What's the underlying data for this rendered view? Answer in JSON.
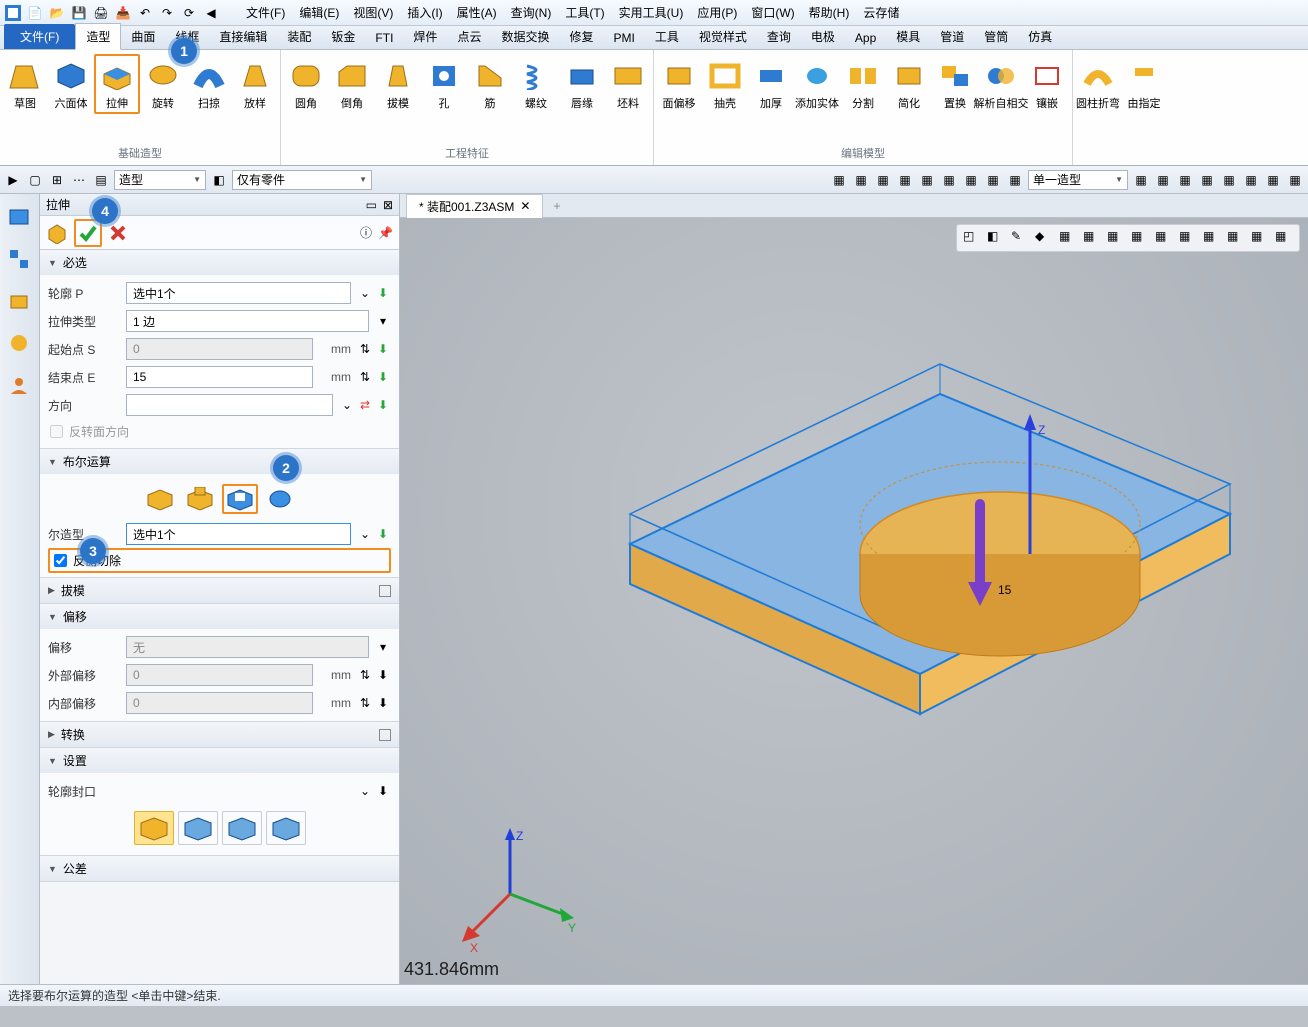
{
  "menu": [
    "文件(F)",
    "编辑(E)",
    "视图(V)",
    "插入(I)",
    "属性(A)",
    "查询(N)",
    "工具(T)",
    "实用工具(U)",
    "应用(P)",
    "窗口(W)",
    "帮助(H)",
    "云存储"
  ],
  "tabs": {
    "file": "文件(F)",
    "items": [
      "造型",
      "曲面",
      "线框",
      "直接编辑",
      "装配",
      "钣金",
      "FTI",
      "焊件",
      "点云",
      "数据交换",
      "修复",
      "PMI",
      "工具",
      "视觉样式",
      "查询",
      "电极",
      "App",
      "模具",
      "管道",
      "管筒",
      "仿真"
    ],
    "active": "造型"
  },
  "ribbon": {
    "g1": {
      "label": "基础造型",
      "btns": [
        "草图",
        "六面体",
        "拉伸",
        "旋转",
        "扫掠",
        "放样"
      ]
    },
    "g2": {
      "label": "工程特征",
      "btns": [
        "圆角",
        "倒角",
        "拔模",
        "孔",
        "筋",
        "螺纹",
        "唇缘",
        "坯料"
      ]
    },
    "g3": {
      "label": "编辑模型",
      "btns": [
        "面偏移",
        "抽壳",
        "加厚",
        "添加实体",
        "分割",
        "简化",
        "置换",
        "解析自相交",
        "镶嵌"
      ]
    },
    "g4": {
      "label": "",
      "btns": [
        "圆柱折弯",
        "由指定"
      ]
    }
  },
  "qselects": {
    "mode": "造型",
    "filter": "仅有零件",
    "display": "单一造型"
  },
  "panel": {
    "title": "拉伸",
    "s_required": "必选",
    "profile_l": "轮廓 P",
    "profile_v": "选中1个",
    "type_l": "拉伸类型",
    "type_v": "1 边",
    "start_l": "起始点 S",
    "start_v": "0",
    "end_l": "结束点 E",
    "end_v": "15",
    "dir_l": "方向",
    "dir_v": "",
    "unit": "mm",
    "revface": "反转面方向",
    "s_bool": "布尔运算",
    "boolshape_l": "尔造型",
    "boolshape_v": "选中1个",
    "revcut": "反侧切除",
    "s_draft": "拔模",
    "s_offset": "偏移",
    "off_l": "偏移",
    "off_v": "无",
    "outoff_l": "外部偏移",
    "outoff_v": "0",
    "inoff_l": "内部偏移",
    "inoff_v": "0",
    "s_trans": "转换",
    "s_set": "设置",
    "cap_l": "轮廓封口",
    "s_tol": "公差"
  },
  "doc": {
    "tab": "* 装配001.Z3ASM"
  },
  "viewport": {
    "measure": "431.846mm",
    "extrude_len": "15",
    "axes": [
      "X",
      "Y",
      "Z"
    ]
  },
  "status": "选择要布尔运算的造型  <单击中键>结束.",
  "markers": [
    "1",
    "2",
    "3",
    "4"
  ]
}
